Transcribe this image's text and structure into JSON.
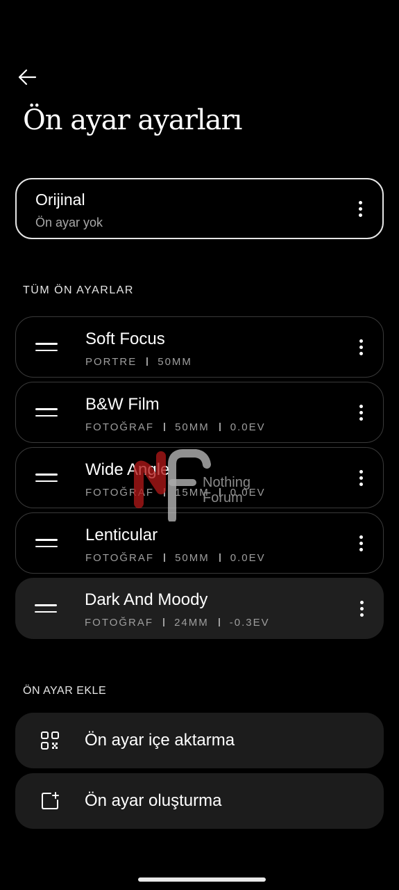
{
  "page": {
    "title": "Ön ayar ayarları"
  },
  "original": {
    "title": "Orijinal",
    "subtitle": "Ön ayar yok"
  },
  "sections": {
    "all_presets": "TÜM ÖN AYARLAR",
    "add_preset": "ÖN AYAR EKLE"
  },
  "presets": [
    {
      "name": "Soft Focus",
      "type": "PORTRE",
      "focal": "50MM",
      "ev": ""
    },
    {
      "name": "B&W Film",
      "type": "FOTOĞRAF",
      "focal": "50MM",
      "ev": "0.0EV"
    },
    {
      "name": "Wide Angle",
      "type": "FOTOĞRAF",
      "focal": "15MM",
      "ev": "0.0EV"
    },
    {
      "name": "Lenticular",
      "type": "FOTOĞRAF",
      "focal": "50MM",
      "ev": "0.0EV"
    },
    {
      "name": "Dark And Moody",
      "type": "FOTOĞRAF",
      "focal": "24MM",
      "ev": "-0.3EV"
    }
  ],
  "add_actions": {
    "import_label": "Ön ayar içe aktarma",
    "create_label": "Ön ayar oluşturma"
  },
  "watermark": {
    "line1": "Nothing",
    "line2": "Forum"
  },
  "icons": {
    "back": "arrow-left-icon",
    "more": "more-vertical-icon",
    "drag": "drag-handle-icon",
    "import": "qr-code-icon",
    "create": "add-box-icon"
  }
}
